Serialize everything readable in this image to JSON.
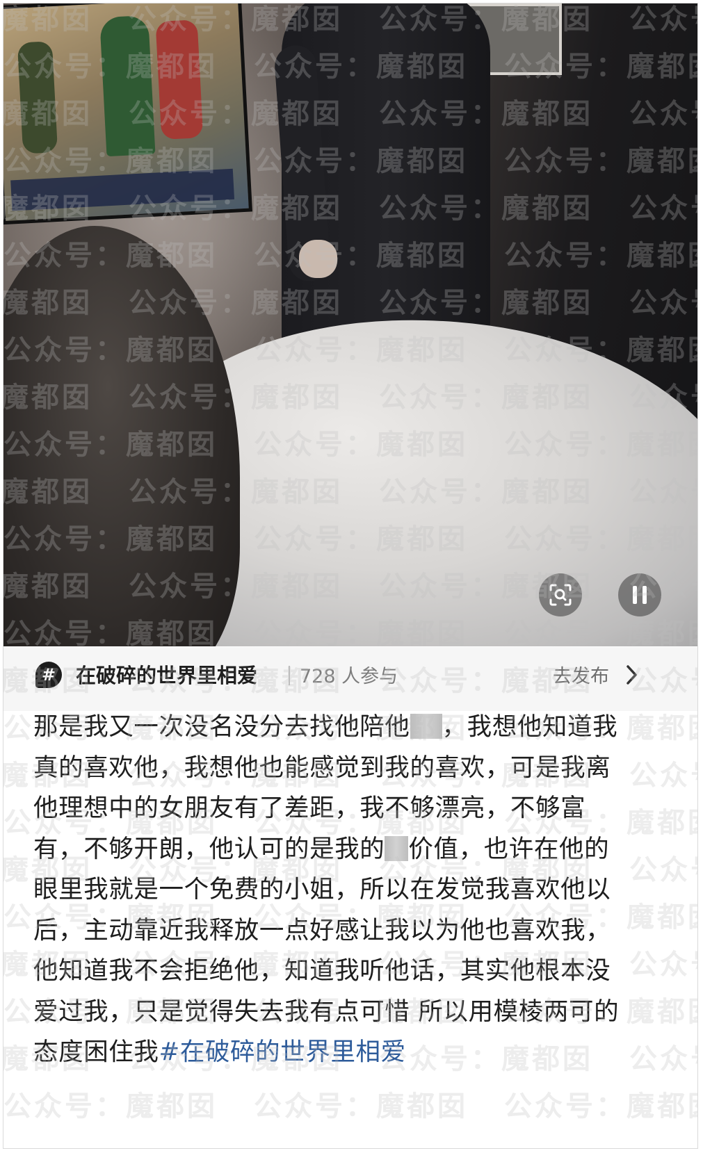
{
  "topic": {
    "icon": "hashtag-icon",
    "title": "在破碎的世界里相爱",
    "participants": "728 人参与",
    "publish_label": "去发布"
  },
  "post": {
    "lines": [
      [
        "那是我又一次没名没分去找他陪他",
        "，我想他知道我"
      ],
      [
        "真的喜欢他，我想他也能感觉到我的喜欢，可是我离"
      ],
      [
        "他理想中的女朋友有了差距，我不够漂亮，不够富"
      ],
      [
        "有，不够开朗，他认可的是我的",
        "价值，也许在他的"
      ],
      [
        "眼里我就是一个免费的小姐，所以在发觉我喜欢他以"
      ],
      [
        "后，主动靠近我释放一点好感让我以为他也喜欢我，"
      ],
      [
        "他知道我不会拒绝他，知道我听他话，其实他根本没"
      ],
      [
        "爱过我，只是觉得失去我有点可惜 所以用模棱两可的"
      ],
      [
        "态度困住我"
      ]
    ],
    "hashtag": "#在破碎的世界里相爱"
  },
  "watermark": {
    "texts": [
      "公众号：魔都囡"
    ]
  },
  "video": {
    "controls": [
      "image-search-icon",
      "pause-icon"
    ]
  }
}
